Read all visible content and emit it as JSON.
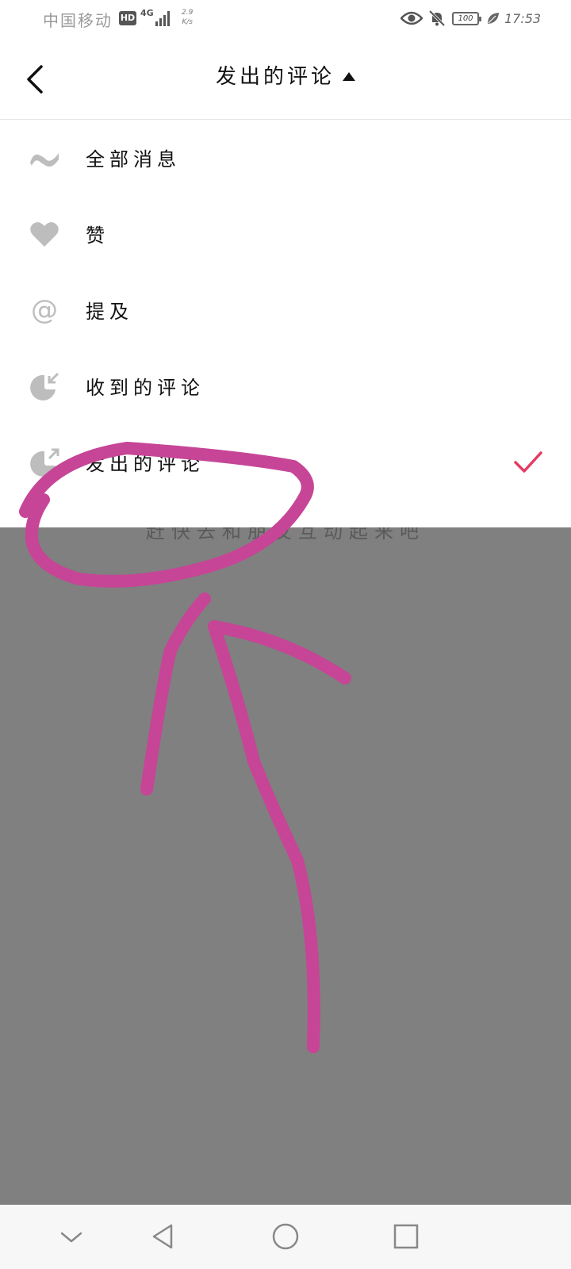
{
  "status_bar": {
    "carrier": "中国移动",
    "hd_badge": "HD",
    "network": "4G",
    "speed_value": "2.9",
    "speed_unit": "K/s",
    "battery": "100",
    "time": "17:53"
  },
  "header": {
    "title": "发出的评论"
  },
  "menu": {
    "items": [
      {
        "label": "全部消息",
        "icon": "wave-icon",
        "selected": false
      },
      {
        "label": "赞",
        "icon": "heart-icon",
        "selected": false
      },
      {
        "label": "提及",
        "icon": "at-icon",
        "selected": false
      },
      {
        "label": "收到的评论",
        "icon": "comment-received-icon",
        "selected": false
      },
      {
        "label": "发出的评论",
        "icon": "comment-sent-icon",
        "selected": true
      }
    ]
  },
  "overlay": {
    "hint_text": "赶快去和朋友互动起来吧"
  },
  "colors": {
    "accent": "#e33c64",
    "annotation": "#c64596",
    "overlay": "#808080",
    "icon_gray": "#bdbdbd"
  }
}
